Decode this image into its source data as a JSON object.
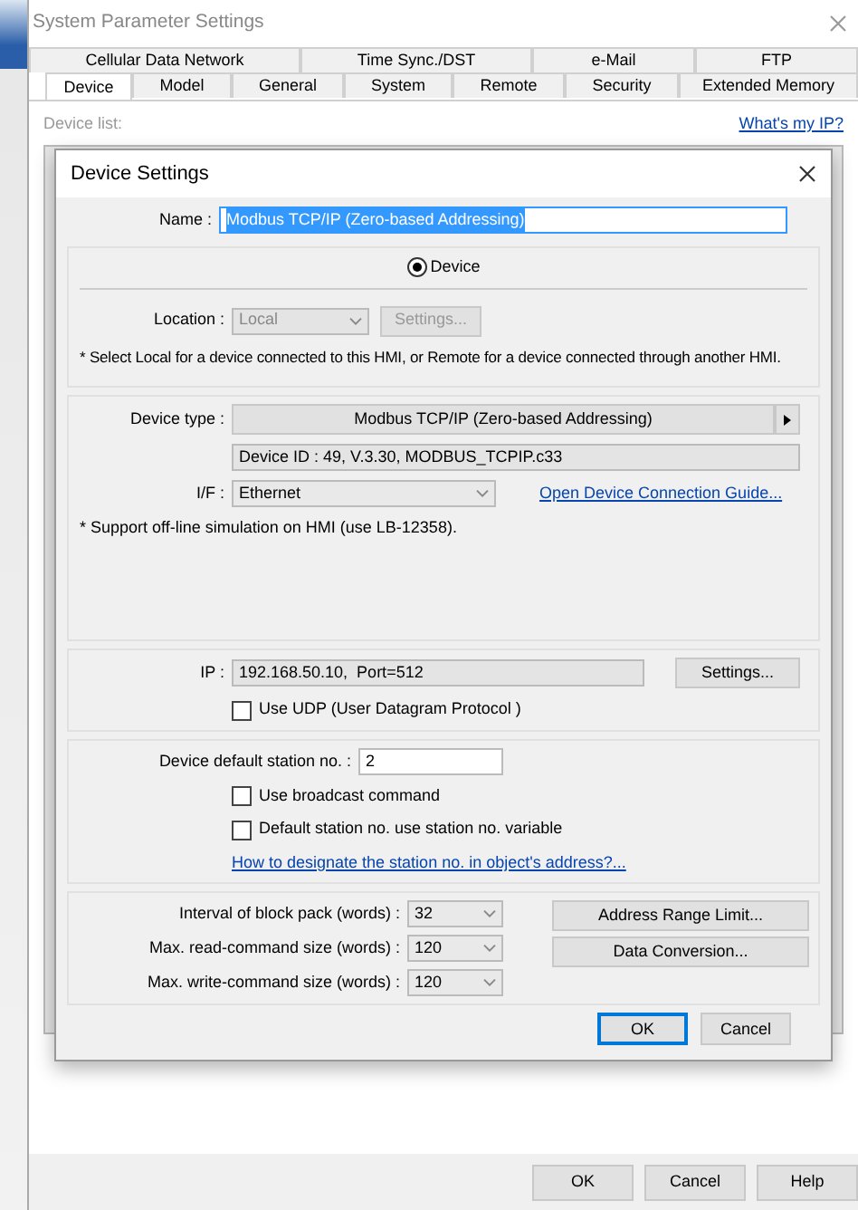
{
  "window": {
    "title": "System Parameter Settings"
  },
  "tabs_row_1": [
    {
      "label": "Cellular Data Network",
      "selected": false
    },
    {
      "label": "Time Sync./DST",
      "selected": false
    },
    {
      "label": "e-Mail",
      "selected": false
    },
    {
      "label": "FTP",
      "selected": false
    }
  ],
  "tabs_row_2": [
    {
      "label": "Device",
      "selected": true
    },
    {
      "label": "Model",
      "selected": false
    },
    {
      "label": "General",
      "selected": false
    },
    {
      "label": "System",
      "selected": false
    },
    {
      "label": "Remote",
      "selected": false
    },
    {
      "label": "Security",
      "selected": false
    },
    {
      "label": "Extended Memory",
      "selected": false
    }
  ],
  "device_list": {
    "label": "Device list:",
    "link": "What's my IP?"
  },
  "dialog": {
    "title": "Device Settings",
    "name": {
      "label": "Name :",
      "value": "Modbus TCP/IP (Zero-based Addressing)",
      "text_selected": true
    },
    "location_group": {
      "radio": {
        "label": "Device",
        "checked": true
      },
      "location": {
        "label": "Location :",
        "value": "Local",
        "disabled": true
      },
      "settings_button": {
        "label": "Settings...",
        "disabled": true
      },
      "note": "* Select Local for a device connected to this HMI, or Remote for a device connected through another HMI."
    },
    "device_group": {
      "device_type": {
        "label": "Device type :",
        "value": "Modbus TCP/IP (Zero-based Addressing)"
      },
      "device_id": "Device ID : 49, V.3.30, MODBUS_TCPIP.c33",
      "interface": {
        "label": "I/F :",
        "value": "Ethernet"
      },
      "guide_link": "Open Device Connection Guide...",
      "note": "* Support off-line simulation on HMI (use LB-12358)."
    },
    "ip_group": {
      "label": "IP :",
      "value": "192.168.50.10,  Port=512",
      "settings_button": "Settings...",
      "udp": {
        "label": "Use UDP (User Datagram Protocol )",
        "checked": false
      }
    },
    "station_group": {
      "label": "Device default station no. :",
      "value": "2",
      "options": [
        {
          "label": "Use broadcast command",
          "checked": false
        },
        {
          "label": "Default station no. use station no. variable",
          "checked": false
        }
      ],
      "link": "How to designate the station no. in object's address?..."
    },
    "block_group": {
      "rows": [
        {
          "label": "Interval of block pack (words) :",
          "value": "32"
        },
        {
          "label": "Max. read-command size (words) :",
          "value": "120"
        },
        {
          "label": "Max. write-command size (words) :",
          "value": "120"
        }
      ],
      "buttons": [
        "Address Range Limit...",
        "Data Conversion..."
      ]
    },
    "buttons": [
      {
        "label": "OK",
        "default": true
      },
      {
        "label": "Cancel",
        "default": false
      }
    ]
  },
  "window_buttons": [
    "OK",
    "Cancel",
    "Help"
  ]
}
